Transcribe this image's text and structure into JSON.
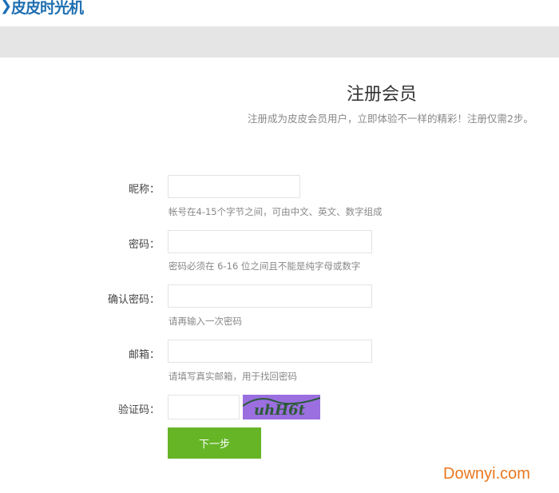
{
  "logo": {
    "text": "皮皮时光机"
  },
  "page": {
    "title": "注册会员",
    "subtitle": "注册成为皮皮会员用户，立即体验不一样的精彩！注册仅需2步。"
  },
  "form": {
    "nickname": {
      "label": "昵称：",
      "hint": "帐号在4-15个字节之间，可由中文、英文、数字组成",
      "value": ""
    },
    "password": {
      "label": "密码：",
      "hint": "密码必须在 6-16 位之间且不能是纯字母或数字",
      "value": ""
    },
    "confirm": {
      "label": "确认密码：",
      "hint": "请再输入一次密码",
      "value": ""
    },
    "email": {
      "label": "邮箱：",
      "hint": "请填写真实邮箱，用于找回密码",
      "value": ""
    },
    "captcha": {
      "label": "验证码：",
      "value": "",
      "image_text": "uhH6t"
    },
    "submit": "下一步"
  },
  "watermark": "Downyi.com",
  "colors": {
    "accent": "#66b527",
    "logo": "#1f6fb0",
    "captcha_bg": "#9b6fe0"
  }
}
